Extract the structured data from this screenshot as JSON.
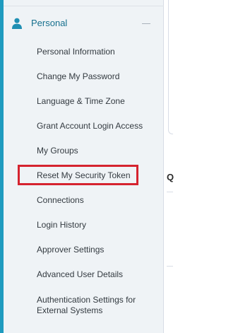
{
  "sidebar": {
    "section_title": "Personal",
    "section_icon": "person-icon",
    "collapse_icon": "minus-icon",
    "accent_color": "#1f9bbf",
    "items": [
      {
        "label": "Personal Information"
      },
      {
        "label": "Change My Password"
      },
      {
        "label": "Language & Time Zone"
      },
      {
        "label": "Grant Account Login Access"
      },
      {
        "label": "My Groups"
      },
      {
        "label": "Reset My Security Token",
        "highlighted": true
      },
      {
        "label": "Connections"
      },
      {
        "label": "Login History"
      },
      {
        "label": "Approver Settings"
      },
      {
        "label": "Advanced User Details"
      },
      {
        "label": "Authentication Settings for External Systems"
      }
    ]
  },
  "highlight_color": "#d5232f",
  "right_panel": {
    "heading_fragment": "Q"
  }
}
